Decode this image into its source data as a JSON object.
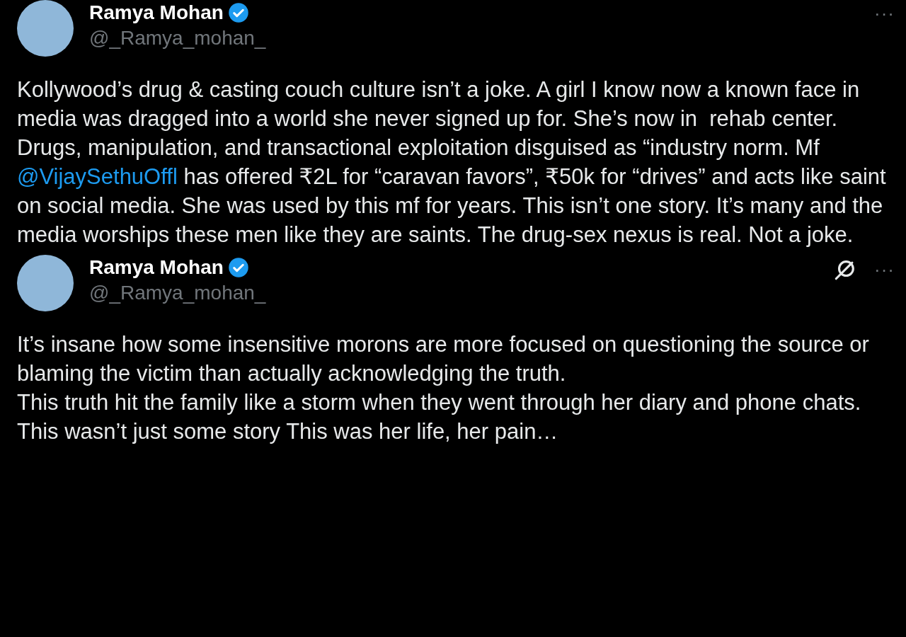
{
  "tweets": [
    {
      "name": "Ramya Mohan",
      "verified": true,
      "handle": "@_Ramya_mohan_",
      "grok_button": false,
      "more": "···",
      "paragraphs": [
        [
          {
            "kind": "text",
            "text": "Kollywood’s drug & casting couch culture isn’t a joke. A girl I know now a known face in media was dragged into a world she never signed up for. She’s now in  rehab center. Drugs, manipulation, and transactional exploitation disguised as “industry norm. Mf "
          },
          {
            "kind": "mention",
            "text": "@VijaySethuOffl"
          },
          {
            "kind": "text",
            "text": " has offered ₹2L for “caravan favors”, ₹50k for “drives” and acts like saint on social media. She was used by this mf for years. This isn’t one story. It’s many and the media worships these men like they are saints. The drug-sex nexus is real. Not a joke."
          }
        ]
      ]
    },
    {
      "name": "Ramya Mohan",
      "verified": true,
      "handle": "@_Ramya_mohan_",
      "grok_button": true,
      "more": "···",
      "paragraphs": [
        [
          {
            "kind": "text",
            "text": "It’s insane how some insensitive morons are more focused on questioning the source or blaming the victim than actually acknowledging the truth."
          }
        ],
        [
          {
            "kind": "text",
            "text": "This truth hit the family like a storm when they went through her diary and phone chats. This wasn’t just some story This was her life, her pain…"
          }
        ]
      ]
    }
  ]
}
